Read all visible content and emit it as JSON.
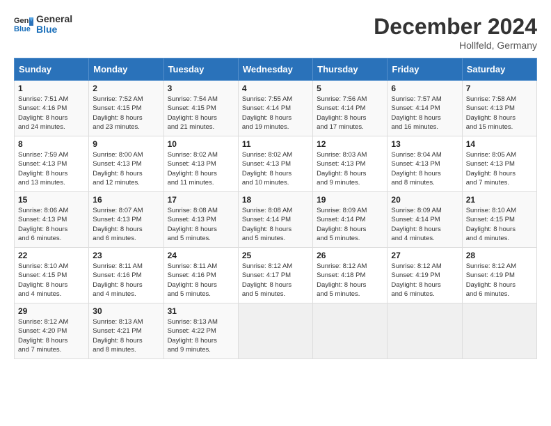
{
  "header": {
    "logo_line1": "General",
    "logo_line2": "Blue",
    "month": "December 2024",
    "location": "Hollfeld, Germany"
  },
  "columns": [
    "Sunday",
    "Monday",
    "Tuesday",
    "Wednesday",
    "Thursday",
    "Friday",
    "Saturday"
  ],
  "weeks": [
    [
      {
        "day": "1",
        "data": "Sunrise: 7:51 AM\nSunset: 4:16 PM\nDaylight: 8 hours\nand 24 minutes."
      },
      {
        "day": "2",
        "data": "Sunrise: 7:52 AM\nSunset: 4:15 PM\nDaylight: 8 hours\nand 23 minutes."
      },
      {
        "day": "3",
        "data": "Sunrise: 7:54 AM\nSunset: 4:15 PM\nDaylight: 8 hours\nand 21 minutes."
      },
      {
        "day": "4",
        "data": "Sunrise: 7:55 AM\nSunset: 4:14 PM\nDaylight: 8 hours\nand 19 minutes."
      },
      {
        "day": "5",
        "data": "Sunrise: 7:56 AM\nSunset: 4:14 PM\nDaylight: 8 hours\nand 17 minutes."
      },
      {
        "day": "6",
        "data": "Sunrise: 7:57 AM\nSunset: 4:14 PM\nDaylight: 8 hours\nand 16 minutes."
      },
      {
        "day": "7",
        "data": "Sunrise: 7:58 AM\nSunset: 4:13 PM\nDaylight: 8 hours\nand 15 minutes."
      }
    ],
    [
      {
        "day": "8",
        "data": "Sunrise: 7:59 AM\nSunset: 4:13 PM\nDaylight: 8 hours\nand 13 minutes."
      },
      {
        "day": "9",
        "data": "Sunrise: 8:00 AM\nSunset: 4:13 PM\nDaylight: 8 hours\nand 12 minutes."
      },
      {
        "day": "10",
        "data": "Sunrise: 8:02 AM\nSunset: 4:13 PM\nDaylight: 8 hours\nand 11 minutes."
      },
      {
        "day": "11",
        "data": "Sunrise: 8:02 AM\nSunset: 4:13 PM\nDaylight: 8 hours\nand 10 minutes."
      },
      {
        "day": "12",
        "data": "Sunrise: 8:03 AM\nSunset: 4:13 PM\nDaylight: 8 hours\nand 9 minutes."
      },
      {
        "day": "13",
        "data": "Sunrise: 8:04 AM\nSunset: 4:13 PM\nDaylight: 8 hours\nand 8 minutes."
      },
      {
        "day": "14",
        "data": "Sunrise: 8:05 AM\nSunset: 4:13 PM\nDaylight: 8 hours\nand 7 minutes."
      }
    ],
    [
      {
        "day": "15",
        "data": "Sunrise: 8:06 AM\nSunset: 4:13 PM\nDaylight: 8 hours\nand 6 minutes."
      },
      {
        "day": "16",
        "data": "Sunrise: 8:07 AM\nSunset: 4:13 PM\nDaylight: 8 hours\nand 6 minutes."
      },
      {
        "day": "17",
        "data": "Sunrise: 8:08 AM\nSunset: 4:13 PM\nDaylight: 8 hours\nand 5 minutes."
      },
      {
        "day": "18",
        "data": "Sunrise: 8:08 AM\nSunset: 4:14 PM\nDaylight: 8 hours\nand 5 minutes."
      },
      {
        "day": "19",
        "data": "Sunrise: 8:09 AM\nSunset: 4:14 PM\nDaylight: 8 hours\nand 5 minutes."
      },
      {
        "day": "20",
        "data": "Sunrise: 8:09 AM\nSunset: 4:14 PM\nDaylight: 8 hours\nand 4 minutes."
      },
      {
        "day": "21",
        "data": "Sunrise: 8:10 AM\nSunset: 4:15 PM\nDaylight: 8 hours\nand 4 minutes."
      }
    ],
    [
      {
        "day": "22",
        "data": "Sunrise: 8:10 AM\nSunset: 4:15 PM\nDaylight: 8 hours\nand 4 minutes."
      },
      {
        "day": "23",
        "data": "Sunrise: 8:11 AM\nSunset: 4:16 PM\nDaylight: 8 hours\nand 4 minutes."
      },
      {
        "day": "24",
        "data": "Sunrise: 8:11 AM\nSunset: 4:16 PM\nDaylight: 8 hours\nand 5 minutes."
      },
      {
        "day": "25",
        "data": "Sunrise: 8:12 AM\nSunset: 4:17 PM\nDaylight: 8 hours\nand 5 minutes."
      },
      {
        "day": "26",
        "data": "Sunrise: 8:12 AM\nSunset: 4:18 PM\nDaylight: 8 hours\nand 5 minutes."
      },
      {
        "day": "27",
        "data": "Sunrise: 8:12 AM\nSunset: 4:19 PM\nDaylight: 8 hours\nand 6 minutes."
      },
      {
        "day": "28",
        "data": "Sunrise: 8:12 AM\nSunset: 4:19 PM\nDaylight: 8 hours\nand 6 minutes."
      }
    ],
    [
      {
        "day": "29",
        "data": "Sunrise: 8:12 AM\nSunset: 4:20 PM\nDaylight: 8 hours\nand 7 minutes."
      },
      {
        "day": "30",
        "data": "Sunrise: 8:13 AM\nSunset: 4:21 PM\nDaylight: 8 hours\nand 8 minutes."
      },
      {
        "day": "31",
        "data": "Sunrise: 8:13 AM\nSunset: 4:22 PM\nDaylight: 8 hours\nand 9 minutes."
      },
      null,
      null,
      null,
      null
    ]
  ]
}
